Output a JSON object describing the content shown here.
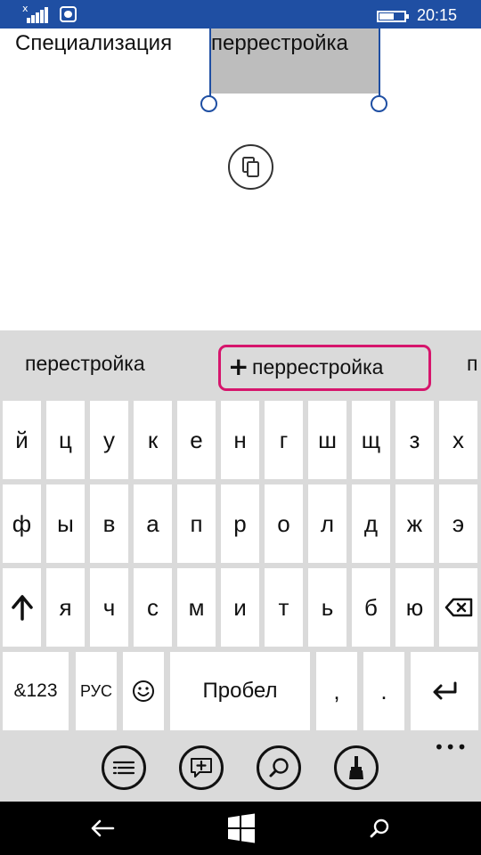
{
  "status_bar": {
    "time": "20:15",
    "signal_marker": "x",
    "battery_level": 0.6,
    "icons": [
      "signal-icon",
      "sync-icon",
      "battery-icon"
    ]
  },
  "document": {
    "prefix_text": "Специализация",
    "selected_word": "перрестройка"
  },
  "selection": {
    "copy_icon": "copy-icon"
  },
  "keyboard": {
    "suggestions": {
      "left": "перестройка",
      "add_word": "перрестройка",
      "right_partial": "п"
    },
    "rows": [
      [
        "й",
        "ц",
        "у",
        "к",
        "е",
        "н",
        "г",
        "ш",
        "щ",
        "з",
        "х"
      ],
      [
        "ф",
        "ы",
        "в",
        "а",
        "п",
        "р",
        "о",
        "л",
        "д",
        "ж",
        "э"
      ],
      [
        "я",
        "ч",
        "с",
        "м",
        "и",
        "т",
        "ь",
        "б",
        "ю"
      ]
    ],
    "bottom_row": {
      "symbols": "&123",
      "language": "РУС",
      "space": "Пробел",
      "comma": ",",
      "period": "."
    },
    "function_icons": [
      "list-icon",
      "add-comment-icon",
      "search-icon",
      "format-painter-icon"
    ],
    "more": "•••"
  },
  "nav_bar": {
    "icons": [
      "back-icon",
      "windows-icon",
      "search-icon"
    ]
  }
}
